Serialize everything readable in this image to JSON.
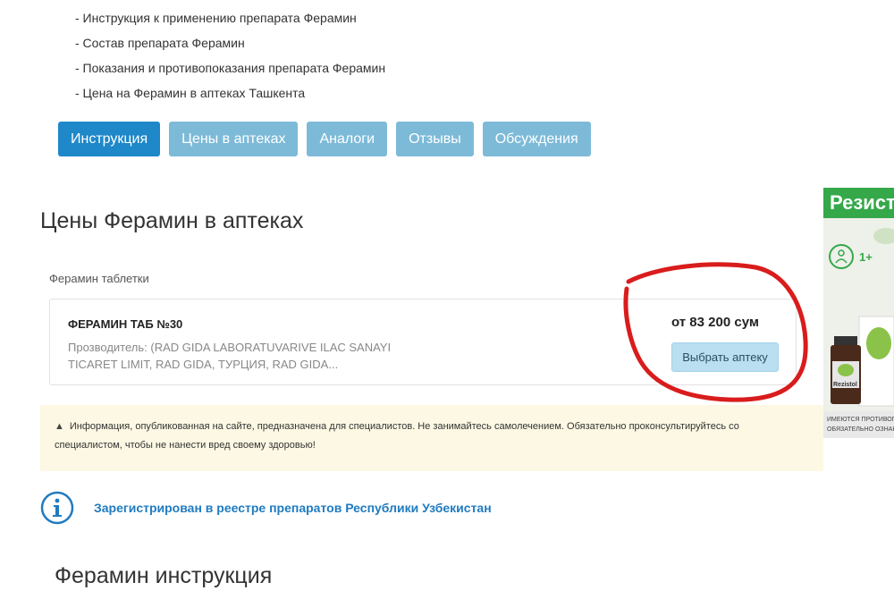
{
  "toc": {
    "items": [
      "- Инструкция к применению препарата Ферамин",
      "- Состав препарата Ферамин",
      "- Показания и противопоказания препарата Ферамин",
      "- Цена на Ферамин в аптеках Ташкента"
    ]
  },
  "tabs": [
    {
      "label": "Инструкция",
      "active": true
    },
    {
      "label": "Цены в аптеках",
      "active": false
    },
    {
      "label": "Аналоги",
      "active": false
    },
    {
      "label": "Отзывы",
      "active": false
    },
    {
      "label": "Обсуждения",
      "active": false
    }
  ],
  "prices": {
    "title": "Цены Ферамин в аптеках",
    "form_label": "Ферамин таблетки",
    "product": {
      "name": "ФЕРАМИН ТАБ №30",
      "manufacturer": "Прозводитель: (RAD GIDA LABORATUVARIVE ILAC SANAYI TICARET LIMIT, RAD GIDA, ТУРЦИЯ, RAD GIDA...",
      "price": "от 83 200 сум",
      "button": "Выбрать аптеку"
    }
  },
  "alert": {
    "text": "Информация, опубликованная на сайте, предназначена для специалистов. Не занимайтесь самолечением. Обязательно проконсультируйтесь со специалистом, чтобы не нанести вред своему здоровью!"
  },
  "registry": {
    "link": "Зарегистрирован в реестре препаратов Республики Узбекистан"
  },
  "instruction": {
    "title": "Ферамин инструкция"
  },
  "ad": {
    "banner": "Резистол",
    "badge": "1+",
    "product": "Rezistol",
    "footer_line1": "ИМЕЮТСЯ ПРОТИВОПОКАЗАНИЯ",
    "footer_line2": "ОБЯЗАТЕЛЬНО ОЗНАКОМЬТЕСЬ"
  },
  "colors": {
    "tab_active": "#1e88c9",
    "tab_inactive": "#7dbad8",
    "alert_bg": "#fcf8e3",
    "link": "#1f7bc0",
    "annotation": "#d91c1c",
    "ad_green": "#35a84a"
  }
}
